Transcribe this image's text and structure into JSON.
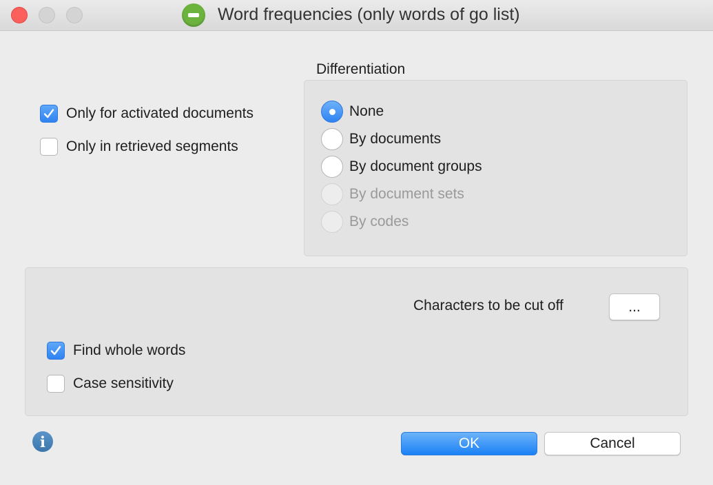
{
  "window": {
    "title": "Word frequencies (only words of go list)"
  },
  "filters": {
    "activated_documents": {
      "label": "Only for activated documents",
      "checked": true
    },
    "retrieved_segments": {
      "label": "Only in retrieved segments",
      "checked": false
    }
  },
  "differentiation": {
    "label": "Differentiation",
    "options": [
      {
        "label": "None",
        "selected": true,
        "enabled": true
      },
      {
        "label": "By documents",
        "selected": false,
        "enabled": true
      },
      {
        "label": "By document groups",
        "selected": false,
        "enabled": true
      },
      {
        "label": "By document sets",
        "selected": false,
        "enabled": false
      },
      {
        "label": "By codes",
        "selected": false,
        "enabled": false
      }
    ]
  },
  "options": {
    "cutoff_label": "Characters to be cut off",
    "cutoff_button": "...",
    "whole_words": {
      "label": "Find whole words",
      "checked": true
    },
    "case_sensitivity": {
      "label": "Case sensitivity",
      "checked": false
    }
  },
  "buttons": {
    "ok": "OK",
    "cancel": "Cancel"
  },
  "icons": {
    "info": "info-icon",
    "checkmark": "checkmark-icon",
    "app": "minus-circle-icon"
  },
  "colors": {
    "accent": "#2f83f2",
    "app_icon": "#6cb33e",
    "close_button": "#fc605c"
  }
}
